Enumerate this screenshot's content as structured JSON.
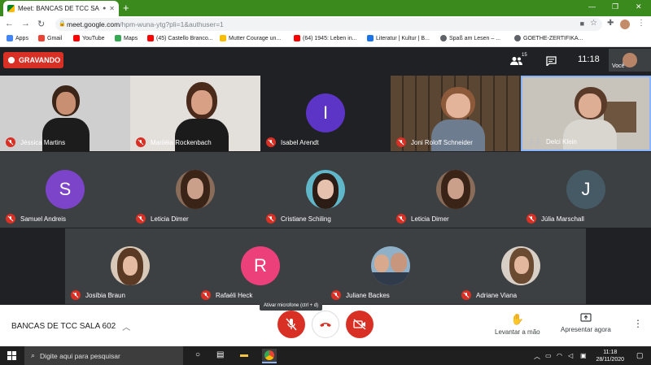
{
  "browser": {
    "tab_title": "Meet: BANCAS DE TCC SALA",
    "new_tab_glyph": "+",
    "url_host": "meet.google.com",
    "url_path": "/hpm-wuna-ytg?pli=1&authuser=1",
    "bookmarks": [
      {
        "label": "Apps",
        "color": "#4285f4"
      },
      {
        "label": "Gmail",
        "color": "#ea4335"
      },
      {
        "label": "YouTube",
        "color": "#ff0000"
      },
      {
        "label": "Maps",
        "color": "#34a853"
      },
      {
        "label": "(45) Castello Branco...",
        "color": "#ff0000"
      },
      {
        "label": "Mutter Courage un...",
        "color": "#fbbc04"
      },
      {
        "label": "(64) 1945: Leben in...",
        "color": "#ff0000"
      },
      {
        "label": "Literatur | Kultur | B...",
        "color": "#1a73e8"
      },
      {
        "label": "Spaß am Lesen – ...",
        "color": "#5f6368"
      },
      {
        "label": "GOETHE-ZERTIFIKA...",
        "color": "#5f6368"
      }
    ]
  },
  "meet": {
    "recording_label": "GRAVANDO",
    "participant_count": "15",
    "time": "11:18",
    "self_label": "Você",
    "tooltip": "Ativar microfone (ctrl + d)",
    "meeting_name": "BANCAS DE TCC SALA 602",
    "raise_hand": "Levantar a mão",
    "present_now": "Apresentar agora"
  },
  "participants": [
    {
      "name": "Jéssica Martins"
    },
    {
      "name": "Mariléia Rockenbach"
    },
    {
      "name": "Isabel Arendt",
      "initial": "I",
      "color": "#5c35c7"
    },
    {
      "name": "Joni Roloff Schneider"
    },
    {
      "name": "Delci Klein"
    },
    {
      "name": "Samuel Andreis",
      "initial": "S",
      "color": "#7b44c9"
    },
    {
      "name": "Leticia Dimer"
    },
    {
      "name": "Cristiane Schiling"
    },
    {
      "name": "Leticia Dimer"
    },
    {
      "name": "Júlia Marschall",
      "initial": "J",
      "color": "#455a64"
    },
    {
      "name": "Josíbia Braun"
    },
    {
      "name": "Rafaéli Heck",
      "initial": "R",
      "color": "#ec407a"
    },
    {
      "name": "Juliane Backes"
    },
    {
      "name": "Adriane Viana"
    }
  ],
  "taskbar": {
    "search_placeholder": "Digite aqui para pesquisar",
    "time": "11:18",
    "date": "28/11/2020"
  }
}
